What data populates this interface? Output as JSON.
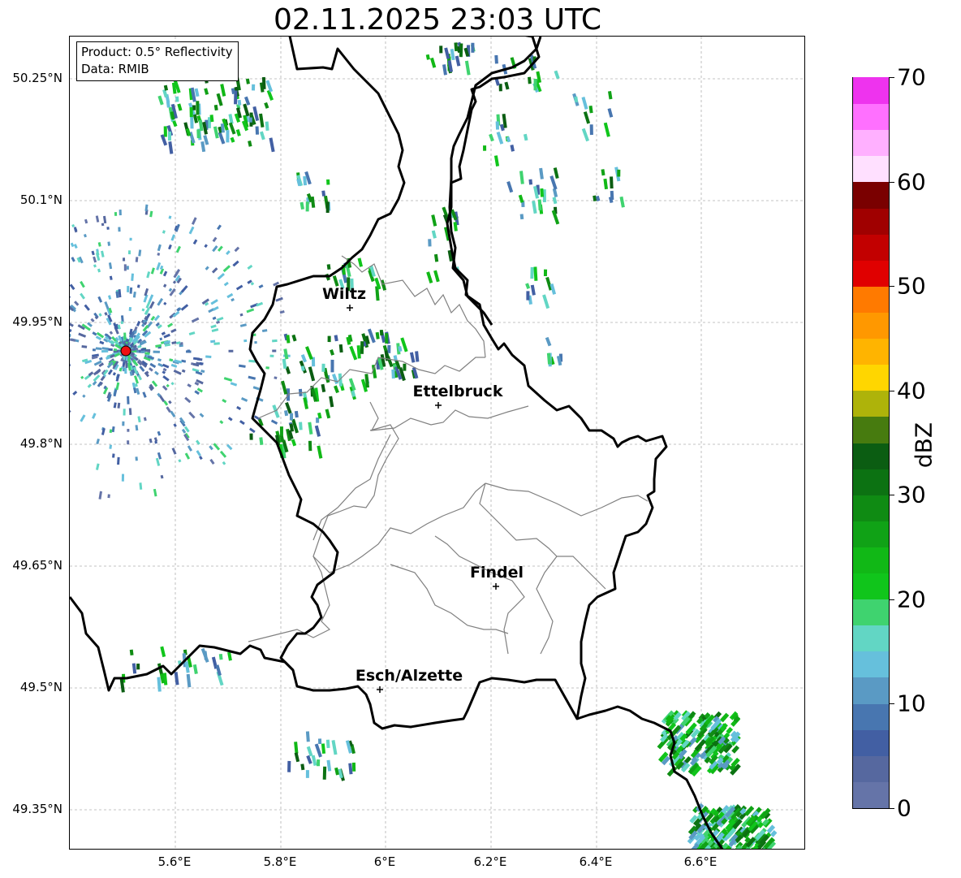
{
  "title": "02.11.2025 23:03 UTC",
  "info_box": {
    "product": "Product: 0.5° Reflectivity",
    "data": "Data: RMIB"
  },
  "latitude_labels": [
    "50.25°N",
    "50.1°N",
    "49.95°N",
    "49.8°N",
    "49.65°N",
    "49.5°N",
    "49.35°N"
  ],
  "longitude_labels": [
    "5.6°E",
    "5.8°E",
    "6°E",
    "6.2°E",
    "6.4°E",
    "6.6°E"
  ],
  "cities": [
    {
      "name": "Wiltz"
    },
    {
      "name": "Ettelbruck"
    },
    {
      "name": "Findel"
    },
    {
      "name": "Esch/Alzette"
    }
  ],
  "radar_site_color": "#ee1111",
  "colorbar": {
    "label": "dBZ",
    "ticks": [
      "0",
      "10",
      "20",
      "30",
      "40",
      "50",
      "60",
      "70"
    ],
    "min": 0,
    "max": 70,
    "step": 2.5,
    "colors": [
      "#6574a8",
      "#56689f",
      "#425fa3",
      "#4876b0",
      "#5a9ac4",
      "#66c0dc",
      "#62d6c4",
      "#3fd36f",
      "#10c51b",
      "#11b816",
      "#10a216",
      "#0f8b13",
      "#0c7212",
      "#0b5d12",
      "#477b0f",
      "#aeb30a",
      "#ffd600",
      "#ffb400",
      "#ff9800",
      "#ff7a00",
      "#e00000",
      "#c20000",
      "#a00000",
      "#7a0000",
      "#ffe0ff",
      "#ffb0ff",
      "#ff70ff",
      "#ee33ee"
    ]
  }
}
